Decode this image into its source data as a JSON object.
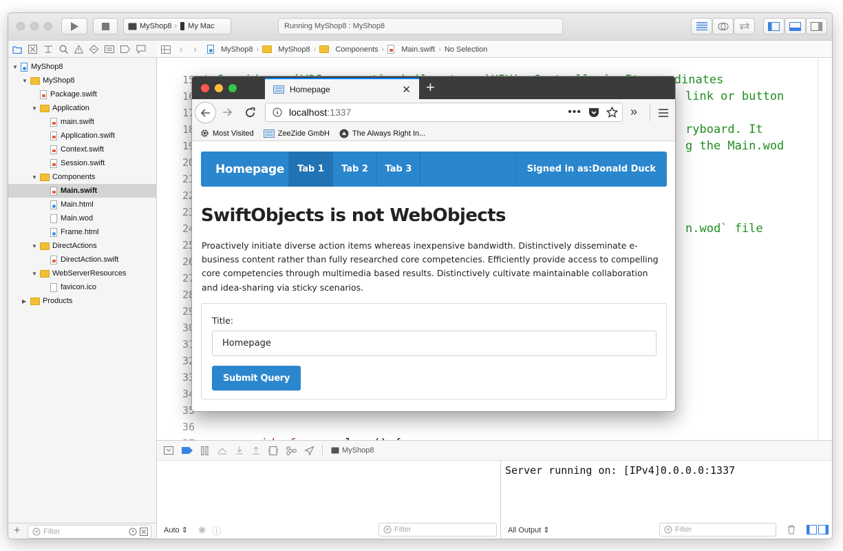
{
  "xcode": {
    "scheme": {
      "project": "MyShop8",
      "destination": "My Mac"
    },
    "activity": "Running MyShop8 : MyShop8",
    "breadcrumb": [
      "MyShop8",
      "MyShop8",
      "Components",
      "Main.swift",
      "No Selection"
    ],
    "navigator": {
      "items": [
        {
          "label": "MyShop8"
        },
        {
          "label": "MyShop8"
        },
        {
          "label": "Package.swift"
        },
        {
          "label": "Application"
        },
        {
          "label": "main.swift"
        },
        {
          "label": "Application.swift"
        },
        {
          "label": "Context.swift"
        },
        {
          "label": "Session.swift"
        },
        {
          "label": "Components"
        },
        {
          "label": "Main.swift"
        },
        {
          "label": "Main.html"
        },
        {
          "label": "Main.wod"
        },
        {
          "label": "Frame.html"
        },
        {
          "label": "DirectActions"
        },
        {
          "label": "DirectAction.swift"
        },
        {
          "label": "WebServerResources"
        },
        {
          "label": "favicon.ico"
        },
        {
          "label": "Products"
        }
      ],
      "filter_placeholder": "Filter"
    },
    "editor": {
      "line_numbers": [
        "15",
        "16",
        "17",
        "18",
        "19",
        "20",
        "21",
        "22",
        "23",
        "24",
        "25",
        "26",
        "27",
        "28",
        "29",
        "30",
        "31",
        "32",
        "33",
        "34",
        "35",
        "36",
        "37"
      ],
      "visible_code": {
        "l15": "* Consider a `WOComponent` similar to a `UIViewController`. It coordinates",
        "l16": "link or button",
        "l18": "ryboard. It",
        "l19": "g the Main.wod",
        "l24": "n.wod` file",
        "l37_kw": "override func",
        "l37_rest": " sleep() {"
      }
    },
    "debug": {
      "process": "MyShop8",
      "vars_mode": "Auto",
      "output_mode": "All Output",
      "filter_placeholder": "Filter"
    },
    "console": {
      "text": "Server running on: [IPv4]0.0.0.0:1337"
    }
  },
  "browser": {
    "tab_title": "Homepage",
    "url": {
      "host": "localhost",
      "port": ":1337"
    },
    "bookmarks": [
      "Most Visited",
      "ZeeZide GmbH",
      "The Always Right In..."
    ],
    "site": {
      "brand": "Homepage",
      "tabs": [
        "Tab 1",
        "Tab 2",
        "Tab 3"
      ],
      "signed_in": "Signed in as:Donald Duck",
      "heading": "SwiftObjects is not WebObjects",
      "paragraph": "Proactively initiate diverse action items whereas inexpensive bandwidth. Distinctively disseminate e-business content rather than fully researched core competencies. Efficiently provide access to compelling core competencies through multimedia based results. Distinctively cultivate maintainable collaboration and idea-sharing via sticky scenarios.",
      "form": {
        "label": "Title:",
        "value": "Homepage",
        "submit": "Submit Query"
      }
    }
  },
  "colors": {
    "accent": "#2a86cd",
    "comment_green": "#1e8e1e",
    "keyword": "#a3248f"
  }
}
